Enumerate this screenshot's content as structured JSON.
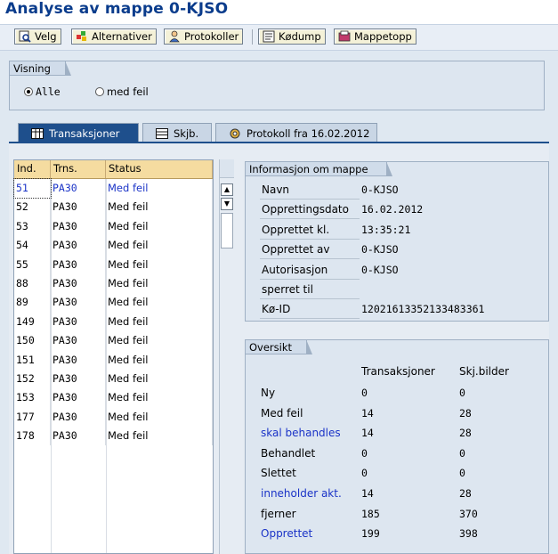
{
  "page_title": "Analyse av mappe 0-KJSO",
  "toolbar": {
    "buttons": [
      {
        "label": "Velg",
        "icon": "select-icon"
      },
      {
        "label": "Alternativer",
        "icon": "options-icon"
      },
      {
        "label": "Protokoller",
        "icon": "log-icon"
      },
      {
        "label": "Kødump",
        "icon": "queue-dump-icon"
      },
      {
        "label": "Mappetopp",
        "icon": "folder-header-icon"
      }
    ]
  },
  "visning": {
    "title": "Visning",
    "options": [
      {
        "label": "Alle",
        "selected": true
      },
      {
        "label": "med feil",
        "selected": false
      }
    ]
  },
  "tabs": [
    {
      "label": "Transaksjoner",
      "active": true,
      "icon": "table-icon"
    },
    {
      "label": "Skjb.",
      "active": false,
      "icon": "screen-icon"
    },
    {
      "label": "Protokoll fra 16.02.2012",
      "active": false,
      "icon": "protocol-icon"
    }
  ],
  "table": {
    "headers": [
      "Ind.",
      "Trns.",
      "Status"
    ],
    "rows": [
      {
        "ind": "51",
        "trns": "PA30",
        "status": "Med feil",
        "blue": true
      },
      {
        "ind": "52",
        "trns": "PA30",
        "status": "Med feil",
        "blue": false
      },
      {
        "ind": "53",
        "trns": "PA30",
        "status": "Med feil",
        "blue": false
      },
      {
        "ind": "54",
        "trns": "PA30",
        "status": "Med feil",
        "blue": false
      },
      {
        "ind": "55",
        "trns": "PA30",
        "status": "Med feil",
        "blue": false
      },
      {
        "ind": "88",
        "trns": "PA30",
        "status": "Med feil",
        "blue": false
      },
      {
        "ind": "89",
        "trns": "PA30",
        "status": "Med feil",
        "blue": false
      },
      {
        "ind": "149",
        "trns": "PA30",
        "status": "Med feil",
        "blue": false
      },
      {
        "ind": "150",
        "trns": "PA30",
        "status": "Med feil",
        "blue": false
      },
      {
        "ind": "151",
        "trns": "PA30",
        "status": "Med feil",
        "blue": false
      },
      {
        "ind": "152",
        "trns": "PA30",
        "status": "Med feil",
        "blue": false
      },
      {
        "ind": "153",
        "trns": "PA30",
        "status": "Med feil",
        "blue": false
      },
      {
        "ind": "177",
        "trns": "PA30",
        "status": "Med feil",
        "blue": false
      },
      {
        "ind": "178",
        "trns": "PA30",
        "status": "Med feil",
        "blue": false
      }
    ]
  },
  "info": {
    "title": "Informasjon om mappe",
    "rows": [
      {
        "label": "Navn",
        "value": "0-KJSO"
      },
      {
        "label": "Opprettingsdato",
        "value": "16.02.2012"
      },
      {
        "label": "Opprettet kl.",
        "value": "13:35:21"
      },
      {
        "label": "Opprettet av",
        "value": "0-KJSO"
      },
      {
        "label": "Autorisasjon",
        "value": "0-KJSO"
      },
      {
        "label": "sperret til",
        "value": ""
      },
      {
        "label": "Kø-ID",
        "value": "12021613352133483361"
      }
    ]
  },
  "oversikt": {
    "title": "Oversikt",
    "col1": "Transaksjoner",
    "col2": "Skj.bilder",
    "rows": [
      {
        "label": "Ny",
        "t": "0",
        "s": "0",
        "link": false
      },
      {
        "label": "Med feil",
        "t": "14",
        "s": "28",
        "link": false
      },
      {
        "label": "skal behandles",
        "t": "14",
        "s": "28",
        "link": true
      },
      {
        "label": "Behandlet",
        "t": "0",
        "s": "0",
        "link": false
      },
      {
        "label": "Slettet",
        "t": "0",
        "s": "0",
        "link": false
      },
      {
        "label": "inneholder akt.",
        "t": "14",
        "s": "28",
        "link": true
      },
      {
        "label": "fjerner",
        "t": "185",
        "s": "370",
        "link": false
      },
      {
        "label": "Opprettet",
        "t": "199",
        "s": "398",
        "link": true
      }
    ]
  },
  "colors": {
    "title": "#0a3c8c",
    "tab_active": "#1e4f8c",
    "table_header": "#f5dca0",
    "link": "#1a33c7"
  }
}
